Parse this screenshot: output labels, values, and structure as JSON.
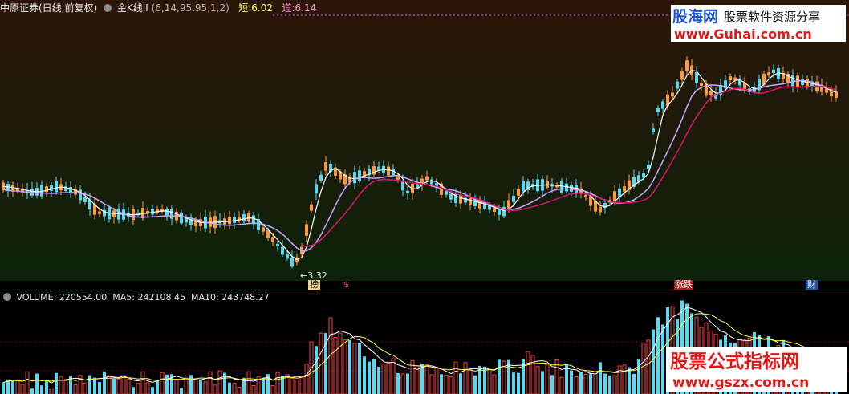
{
  "header": {
    "security_name": "中原证券(日线,前复权)",
    "indicator_name": "金K线II",
    "indicator_params": "(6,14,95,95,1,2)",
    "short_label": "短:",
    "short_value": "6.02",
    "track_label": "道:",
    "track_value": "6.14"
  },
  "price_chart": {
    "low_marker": "3.32",
    "markers": [
      "榜",
      "$",
      "涨跌",
      "财"
    ]
  },
  "volume_header": {
    "volume": "VOLUME: 220554.00",
    "ma5": "MA5: 242108.45",
    "ma10": "MA10: 243748.27"
  },
  "watermarks": {
    "top_line1": "股海网",
    "top_line2": "股票软件资源分享",
    "top_url": "www.Guhai.com.cn",
    "bottom_line1": "股票公式指标网",
    "bottom_url": "www.gszx.com.cn"
  },
  "colors": {
    "up": "#ff9a3c",
    "down": "#5ad8f0",
    "short_line": "#ffffff",
    "track_line": "#c8a8ff",
    "mid_line": "#d81870"
  }
}
